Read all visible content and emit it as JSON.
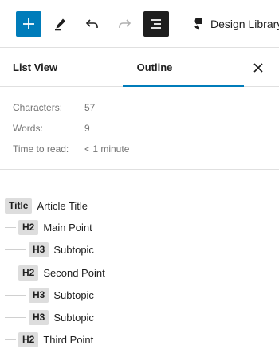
{
  "toolbar": {
    "add_icon": "plus-icon",
    "edit_icon": "pencil-icon",
    "undo_icon": "undo-icon",
    "redo_icon": "redo-icon",
    "outline_icon": "document-overview-icon",
    "design_library_label": "Design Library",
    "design_library_icon": "stackable-logo-icon",
    "accent_color": "#007cba"
  },
  "tabs": {
    "list_view": "List View",
    "outline": "Outline",
    "active": "Outline",
    "close_icon": "close-icon"
  },
  "stats": [
    {
      "label": "Characters:",
      "value": "57"
    },
    {
      "label": "Words:",
      "value": "9"
    },
    {
      "label": "Time to read:",
      "value": "< 1 minute"
    }
  ],
  "outline": [
    {
      "level": "Title",
      "text": "Article Title"
    },
    {
      "level": "H2",
      "text": "Main Point"
    },
    {
      "level": "H3",
      "text": "Subtopic"
    },
    {
      "level": "H2",
      "text": "Second Point"
    },
    {
      "level": "H3",
      "text": "Subtopic"
    },
    {
      "level": "H3",
      "text": "Subtopic"
    },
    {
      "level": "H2",
      "text": "Third Point"
    }
  ]
}
